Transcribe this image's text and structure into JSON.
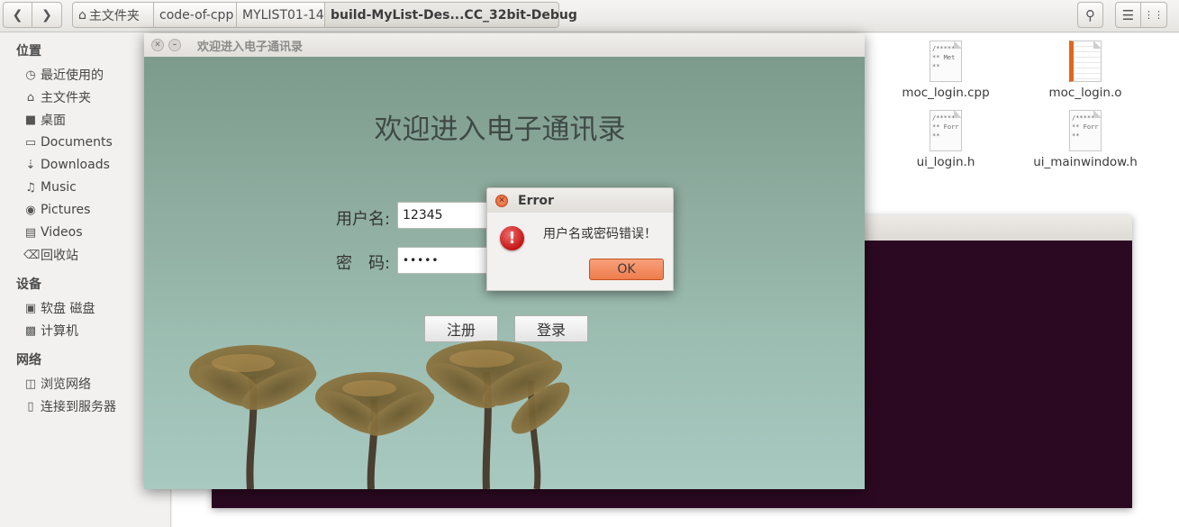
{
  "file_manager": {
    "breadcrumbs": [
      {
        "label": "主文件夹",
        "icon": "home-icon"
      },
      {
        "label": "code-of-cpp"
      },
      {
        "label": "MYLIST01-14"
      },
      {
        "label": "build-MyList-Des...CC_32bit-Debug",
        "active": true
      }
    ],
    "sidebar": {
      "sections": [
        {
          "title": "位置",
          "items": [
            {
              "label": "最近使用的",
              "icon": "clock-icon"
            },
            {
              "label": "主文件夹",
              "icon": "home-icon"
            },
            {
              "label": "桌面",
              "icon": "desktop-folder-icon"
            },
            {
              "label": "Documents",
              "icon": "document-icon"
            },
            {
              "label": "Downloads",
              "icon": "download-icon"
            },
            {
              "label": "Music",
              "icon": "music-icon"
            },
            {
              "label": "Pictures",
              "icon": "camera-icon"
            },
            {
              "label": "Videos",
              "icon": "film-icon"
            },
            {
              "label": "回收站",
              "icon": "trash-icon"
            }
          ]
        },
        {
          "title": "设备",
          "items": [
            {
              "label": "软盘 磁盘",
              "icon": "floppy-icon"
            },
            {
              "label": "计算机",
              "icon": "computer-icon"
            }
          ]
        },
        {
          "title": "网络",
          "items": [
            {
              "label": "浏览网络",
              "icon": "network-icon"
            },
            {
              "label": "连接到服务器",
              "icon": "server-icon"
            }
          ]
        }
      ]
    },
    "files": [
      {
        "name": "moc_login.cpp",
        "preview": "/*****\n** Met\n**"
      },
      {
        "name": "moc_login.o",
        "preview": ""
      },
      {
        "name": "ui_login.h",
        "preview": "/*****\n** Forr\n**"
      },
      {
        "name": "ui_mainwindow.h",
        "preview": "/*****\n** Forr\n**"
      }
    ]
  },
  "login_window": {
    "title": "欢迎进入电子通讯录",
    "heading": "欢迎进入电子通讯录",
    "username_label": "用户名:",
    "username_value": "12345",
    "password_label": "密　码:",
    "password_value": "•••••",
    "register_button": "注册",
    "login_button": "登录"
  },
  "error_dialog": {
    "title": "Error",
    "message": "用户名或密码错误！",
    "ok_button": "OK"
  }
}
